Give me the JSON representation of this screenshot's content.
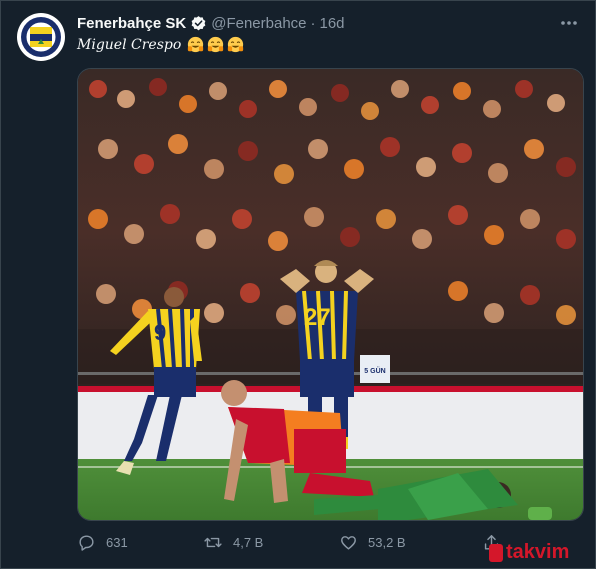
{
  "tweet": {
    "display_name": "Fenerbahçe SK",
    "handle": "@Fenerbahce",
    "separator": "·",
    "time": "16d",
    "text": "Miguel Crespo"
  },
  "actions": {
    "reply_count": "631",
    "retweet_count": "4,7 B",
    "like_count": "53,2 B"
  },
  "icons": {
    "verified": "verified-badge-icon",
    "more": "more-icon",
    "reply": "reply-icon",
    "retweet": "retweet-icon",
    "like": "like-icon",
    "share": "share-icon",
    "emoji": "face-emoji-icon"
  },
  "photo": {
    "jersey_left": "9",
    "jersey_right": "27",
    "banner": "5 GÜN"
  },
  "watermark": {
    "text": "takvim"
  },
  "colors": {
    "background": "#15202b",
    "secondary_text": "#8b98a5",
    "fenerbahce_navy": "#1a2e6c",
    "fenerbahce_yellow": "#f4d21f",
    "galatasaray_red": "#c8102e",
    "galatasaray_orange": "#f47e20",
    "watermark_red": "#d4172a"
  }
}
